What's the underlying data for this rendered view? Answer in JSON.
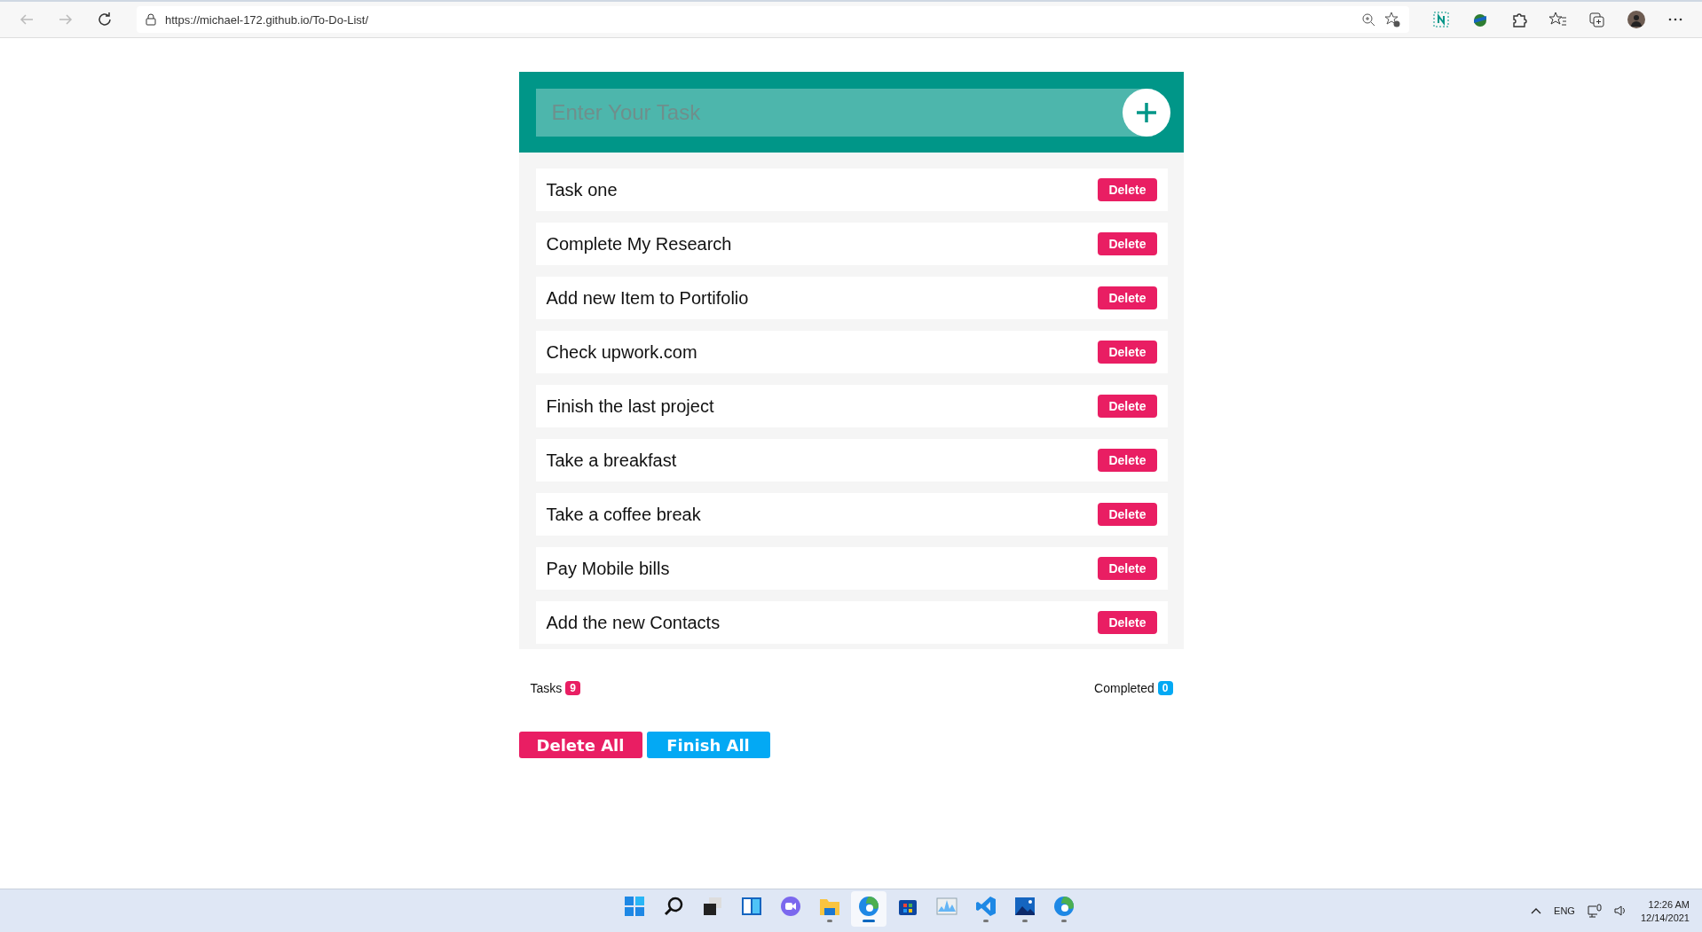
{
  "browser": {
    "url": "https://michael-172.github.io/To-Do-List/"
  },
  "todo": {
    "input": {
      "placeholder": "Enter Your Task"
    },
    "tasks": [
      {
        "name": "Task one",
        "action": "Delete"
      },
      {
        "name": "Complete My Research",
        "action": "Delete"
      },
      {
        "name": "Add new Item to Portifolio",
        "action": "Delete"
      },
      {
        "name": "Check upwork.com",
        "action": "Delete"
      },
      {
        "name": "Finish the last project",
        "action": "Delete"
      },
      {
        "name": "Take a breakfast",
        "action": "Delete"
      },
      {
        "name": "Take a coffee break",
        "action": "Delete"
      },
      {
        "name": "Pay Mobile bills",
        "action": "Delete"
      },
      {
        "name": "Add the new Contacts",
        "action": "Delete"
      }
    ],
    "counts": [
      {
        "label": "Tasks",
        "value": "9",
        "color": "#e91e63"
      },
      {
        "label": "Completed",
        "value": "0",
        "color": "#03a9f4"
      }
    ],
    "buttons": [
      {
        "label": "Delete All",
        "color": "#e91e63"
      },
      {
        "label": "Finish All",
        "color": "#03a9f4"
      }
    ]
  },
  "taskbar": {
    "apps": [
      {
        "kind": "start",
        "selected": false,
        "running": false
      },
      {
        "kind": "search",
        "selected": false,
        "running": false
      },
      {
        "kind": "taskview",
        "selected": false,
        "running": false
      },
      {
        "kind": "widgets",
        "selected": false,
        "running": false
      },
      {
        "kind": "chat",
        "selected": false,
        "running": false
      },
      {
        "kind": "files",
        "selected": false,
        "running": true
      },
      {
        "kind": "edge",
        "selected": true,
        "running": true
      },
      {
        "kind": "store",
        "selected": false,
        "running": false
      },
      {
        "kind": "monitor",
        "selected": false,
        "running": false
      },
      {
        "kind": "code",
        "selected": false,
        "running": true
      },
      {
        "kind": "photos",
        "selected": false,
        "running": true
      },
      {
        "kind": "edge",
        "selected": false,
        "running": true
      }
    ],
    "language": "ENG",
    "time": "12:26 AM",
    "date": "12/14/2021"
  }
}
